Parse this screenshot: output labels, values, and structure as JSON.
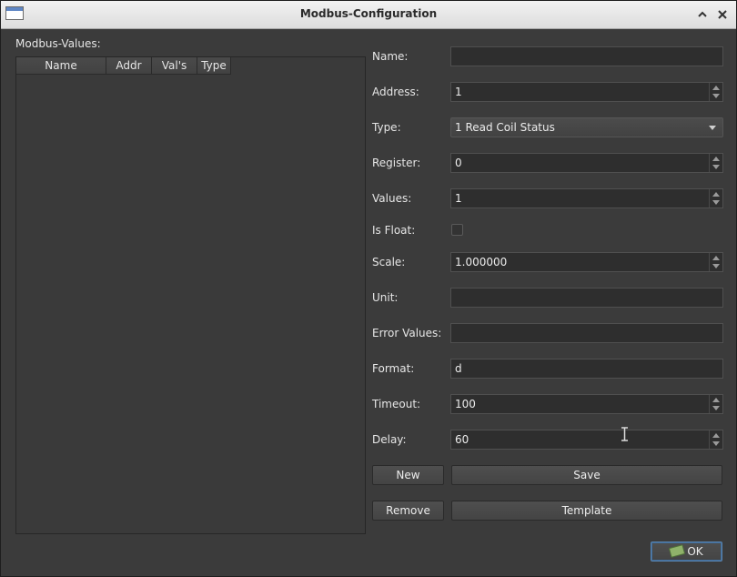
{
  "window": {
    "title": "Modbus-Configuration"
  },
  "left": {
    "group_label": "Modbus-Values:",
    "columns": [
      "Name",
      "Addr",
      "Val's",
      "Type"
    ]
  },
  "form": {
    "name": {
      "label": "Name:",
      "value": ""
    },
    "address": {
      "label": "Address:",
      "value": "1"
    },
    "type": {
      "label": "Type:",
      "value": "1 Read Coil Status"
    },
    "register": {
      "label": "Register:",
      "value": "0"
    },
    "values": {
      "label": "Values:",
      "value": "1"
    },
    "is_float": {
      "label": "Is Float:",
      "checked": false
    },
    "scale": {
      "label": "Scale:",
      "value": "1.000000"
    },
    "unit": {
      "label": "Unit:",
      "value": ""
    },
    "error_values": {
      "label": "Error Values:",
      "value": ""
    },
    "format": {
      "label": "Format:",
      "value": "d"
    },
    "timeout": {
      "label": "Timeout:",
      "value": "100"
    },
    "delay": {
      "label": "Delay:",
      "value": "60"
    }
  },
  "buttons": {
    "new": "New",
    "save": "Save",
    "remove": "Remove",
    "template": "Template",
    "ok": "OK"
  },
  "icons": {
    "app": "window-icon",
    "collapse": "chevron-up-icon",
    "close": "close-icon",
    "ok": "ok-icon"
  }
}
